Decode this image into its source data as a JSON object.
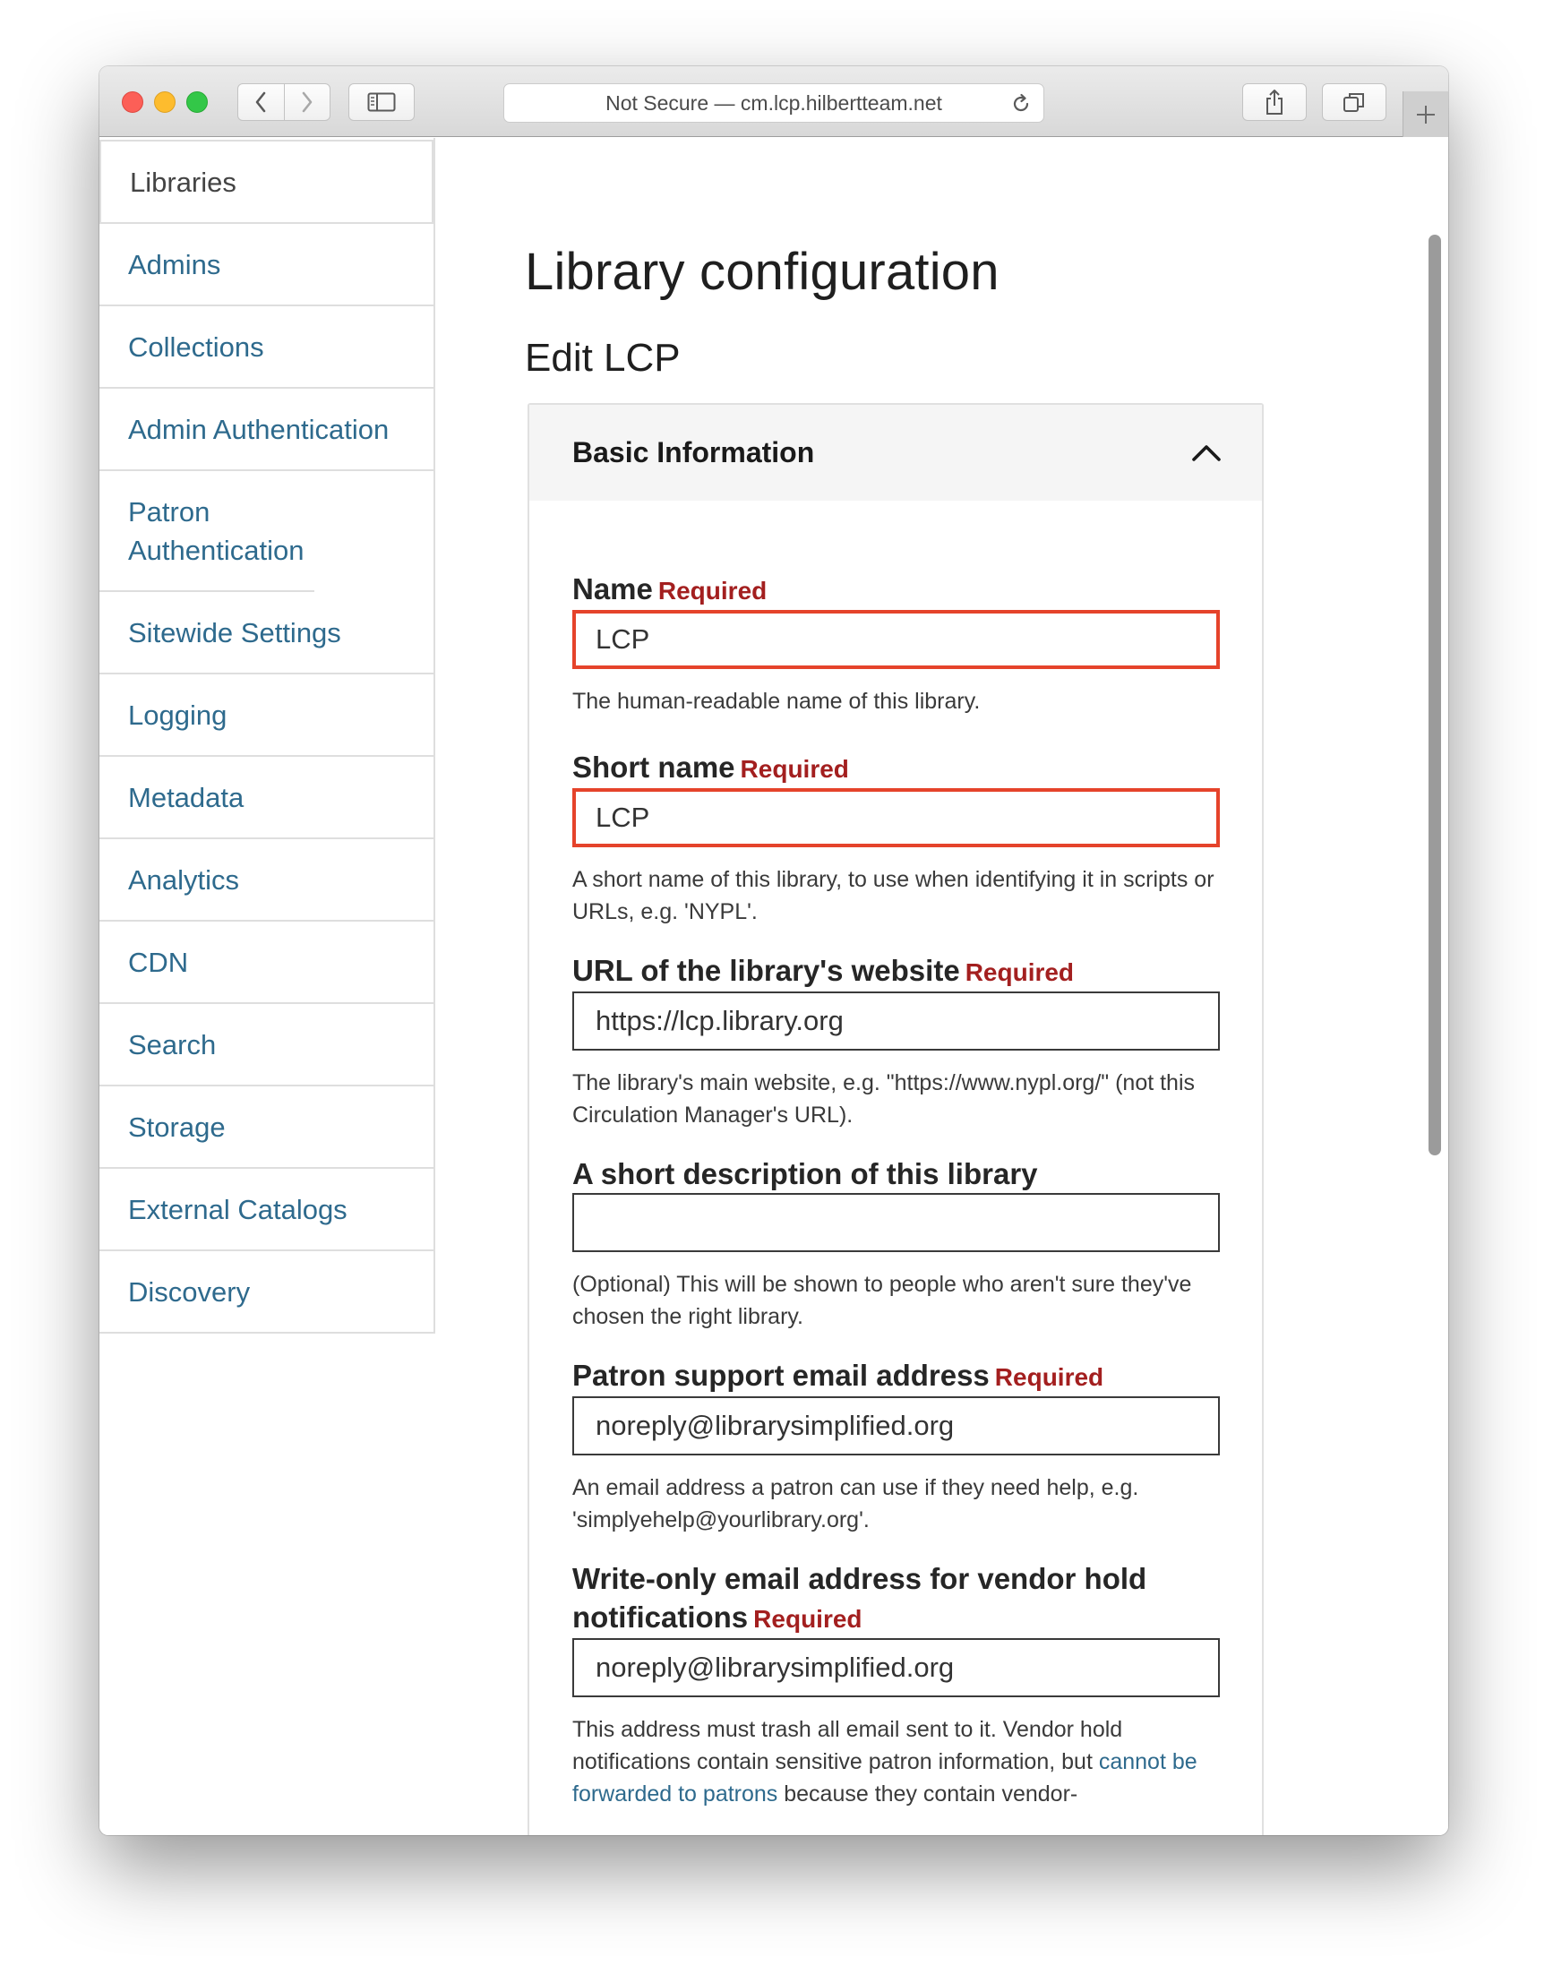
{
  "browser": {
    "address": "Not Secure — cm.lcp.hilbertteam.net",
    "traffic_lights": {
      "close": "#fc5f57",
      "minimize": "#fdbc2e",
      "zoom": "#33c748"
    },
    "icons": [
      "back-chevron-icon",
      "forward-chevron-icon",
      "sidebar-icon",
      "reload-icon",
      "share-icon",
      "tabs-icon",
      "plus-icon"
    ]
  },
  "sidebar": {
    "items": [
      {
        "label": "Libraries",
        "active": true
      },
      {
        "label": "Admins"
      },
      {
        "label": "Collections"
      },
      {
        "label": "Admin Authentication"
      },
      {
        "label": "Patron Authentication"
      },
      {
        "label": "Sitewide Settings"
      },
      {
        "label": "Logging"
      },
      {
        "label": "Metadata"
      },
      {
        "label": "Analytics"
      },
      {
        "label": "CDN"
      },
      {
        "label": "Search"
      },
      {
        "label": "Storage"
      },
      {
        "label": "External Catalogs"
      },
      {
        "label": "Discovery"
      }
    ]
  },
  "main": {
    "title": "Library configuration",
    "subtitle": "Edit LCP",
    "panel": {
      "heading": "Basic Information",
      "toggle_icon": "chevron-up-icon",
      "required_text": "Required",
      "fields": {
        "name": {
          "label": "Name",
          "value": "LCP",
          "help": "The human-readable name of this library."
        },
        "short_name": {
          "label": "Short name",
          "value": "LCP",
          "help": "A short name of this library, to use when identifying it in scripts or URLs, e.g. 'NYPL'."
        },
        "website": {
          "label": "URL of the library's website",
          "value": "https://lcp.library.org",
          "help": "The library's main website, e.g. \"https://www.nypl.org/\" (not this Circulation Manager's URL)."
        },
        "description": {
          "label": "A short description of this library",
          "value": "",
          "help": "(Optional) This will be shown to people who aren't sure they've chosen the right library."
        },
        "support_email": {
          "label": "Patron support email address",
          "value": "noreply@librarysimplified.org",
          "help": "An email address a patron can use if they need help, e.g. 'simplyehelp@yourlibrary.org'."
        },
        "vendor_email": {
          "label": "Write-only email address for vendor hold notifications",
          "value": "noreply@librarysimplified.org",
          "help_before": "This address must trash all email sent to it. Vendor hold notifications contain sensitive patron information, but ",
          "help_link": "cannot be forwarded to patrons",
          "help_after": " because they contain vendor-"
        }
      }
    }
  },
  "colors": {
    "link": "#2e6a8d",
    "required": "#a31f1f",
    "invalid_border": "#e5432b"
  }
}
